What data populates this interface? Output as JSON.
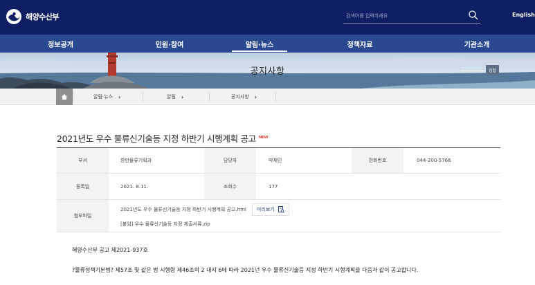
{
  "header": {
    "logo_text": "해양수산부",
    "search_placeholder": "검색어를 입력하세요",
    "lang_link": "English"
  },
  "nav": {
    "items": [
      {
        "label": "정보공개"
      },
      {
        "label": "민원·참여"
      },
      {
        "label": "알림·뉴스",
        "active": true
      },
      {
        "label": "정책자료"
      },
      {
        "label": "기관소개"
      }
    ]
  },
  "banner": {
    "title": "공지사항",
    "chip": "입찰"
  },
  "breadcrumb": {
    "items": [
      "알림·뉴스",
      "알림",
      "공지사항"
    ]
  },
  "post": {
    "title": "2021년도 우수 물류신기술등 지정 하반기 시행계획 공고",
    "new_badge": "NEW",
    "dept_label": "부서",
    "dept_value": "항만물류기획과",
    "manager_label": "담당자",
    "manager_value": "박재민",
    "phone_label": "전화번호",
    "phone_value": "044-200-5766",
    "date_label": "등록일",
    "date_value": "2021. 8.11.",
    "views_label": "조회수",
    "views_value": "177",
    "attach_label": "첨부파일",
    "attach_1": "2021년도 우수 물류신기술등 지정 하반기 시행계획 공고.hml",
    "preview_label": "미리보기",
    "attach_2": "[붙임] 우수 물류신기술등 지정 제출서류.zip"
  },
  "body": {
    "line_1": "해양수산부 공고 제2021-937호",
    "line_2": "?물류정책기본법? 제57조 및 같은 법 시행령 제46조의 2 내지 6에 따라 2021년 우수 물류신기술등 지정 하반기 시행계획을 다음과 같이 공고합니다."
  },
  "colors": {
    "header_bg": "#0e1f63",
    "nav_bg": "#2a4990",
    "new_badge": "#e1493a"
  }
}
